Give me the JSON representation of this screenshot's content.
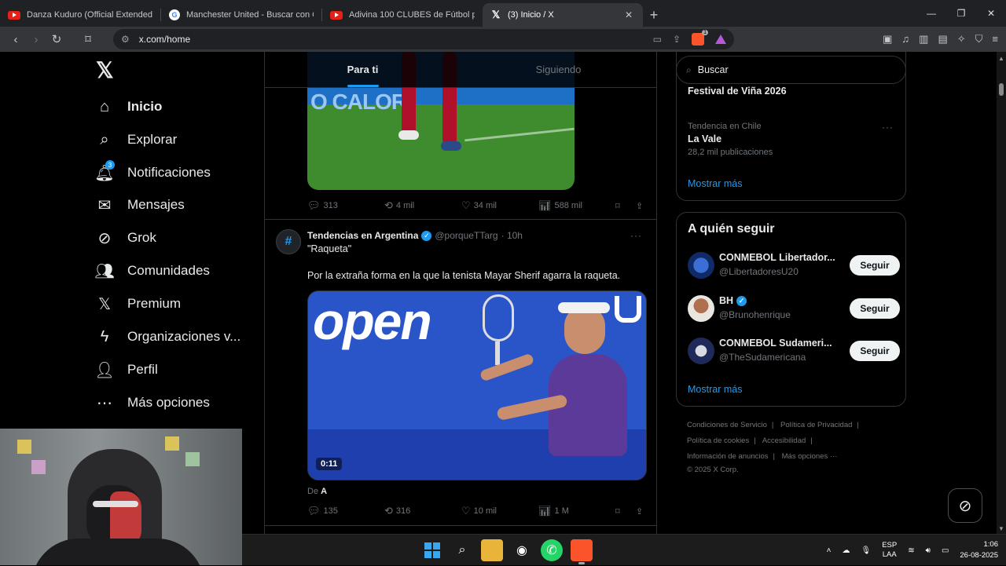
{
  "browser": {
    "tabs": [
      {
        "title": "Danza Kuduro (Official Extended Rem",
        "icon": "youtube-icon"
      },
      {
        "title": "Manchester United - Buscar con Goo",
        "icon": "google-icon"
      },
      {
        "title": "Adivina 100 CLUBES de Fútbol por el",
        "icon": "youtube-icon"
      },
      {
        "title": "(3) Inicio / X",
        "icon": "x-icon",
        "active": true
      }
    ],
    "url": "x.com/home"
  },
  "nav": {
    "items": [
      {
        "label": "Inicio",
        "icon": "home-icon",
        "active": true
      },
      {
        "label": "Explorar",
        "icon": "search-icon"
      },
      {
        "label": "Notificaciones",
        "icon": "bell-icon",
        "badge": "3"
      },
      {
        "label": "Mensajes",
        "icon": "mail-icon"
      },
      {
        "label": "Grok",
        "icon": "grok-icon"
      },
      {
        "label": "Comunidades",
        "icon": "communities-icon"
      },
      {
        "label": "Premium",
        "icon": "x-premium-icon"
      },
      {
        "label": "Organizaciones v...",
        "icon": "lightning-icon"
      },
      {
        "label": "Perfil",
        "icon": "person-icon"
      },
      {
        "label": "Más opciones",
        "icon": "more-circle-icon"
      }
    ]
  },
  "feed": {
    "tabs": {
      "for_you": "Para ti",
      "following": "Siguiendo"
    },
    "post1": {
      "media_text": "O CALORI",
      "replies": "313",
      "reposts": "4 mil",
      "likes": "34 mil",
      "views": "588 mil"
    },
    "post2": {
      "name": "Tendencias en Argentina",
      "handle": "@porqueTTarg",
      "time": "· 10h",
      "line1": "\"Raqueta\"",
      "line2": "Por la extraña forma en la que la tenista Mayar Sherif agarra la raqueta.",
      "media_text": "open",
      "duration": "0:11",
      "from_prefix": "De",
      "from_name": "A",
      "replies": "135",
      "reposts": "316",
      "likes": "10 mil",
      "views": "1 M"
    }
  },
  "sidebar": {
    "search_placeholder": "Buscar",
    "trends": [
      {
        "category": "Tendencia en Chile",
        "title": "Festival de Viña 2026",
        "count": ""
      },
      {
        "category": "Tendencia en Chile",
        "title": "La Vale",
        "count": "28,2 mil publicaciones"
      }
    ],
    "trends_show_more": "Mostrar más",
    "who_to_follow_title": "A quién seguir",
    "follow": [
      {
        "name": "CONMEBOL Libertador...",
        "handle": "@LibertadoresU20",
        "button": "Seguir",
        "verified": false
      },
      {
        "name": "BH",
        "handle": "@Brunohenrique",
        "button": "Seguir",
        "verified": true
      },
      {
        "name": "CONMEBOL Sudameri...",
        "handle": "@TheSudamericana",
        "button": "Seguir",
        "verified": false
      }
    ],
    "follow_show_more": "Mostrar más",
    "footer": {
      "terms": "Condiciones de Servicio",
      "privacy": "Política de Privacidad",
      "cookies": "Política de cookies",
      "accessibility": "Accesibilidad",
      "ads": "Información de anuncios",
      "more": "Más opciones ···",
      "copyright": "© 2025 X Corp."
    }
  },
  "taskbar": {
    "lang1": "ESP",
    "lang2": "LAA",
    "time": "1:06",
    "date": "26-08-2025"
  },
  "colors": {
    "accent": "#1d9bf0",
    "background": "#000000",
    "border": "#2f3336",
    "muted": "#71767b"
  }
}
